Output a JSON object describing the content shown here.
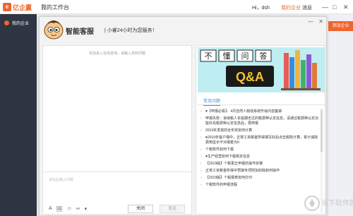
{
  "topbar": {
    "logo_text": "亿企赢",
    "workbench": "我的工作台",
    "user": "Hi，dsh",
    "my_corp": "我的企业",
    "messages": "消息",
    "win_min": "—",
    "win_max": "□",
    "win_close": "✕"
  },
  "sidebar": {
    "item": "我的企业"
  },
  "apply_btn": "添加企业",
  "chat_window": {
    "title": "智能客服",
    "subtitle": "| 小睿24小时为您服务！",
    "min": "—",
    "close": "✕",
    "welcome": "欢迎进入在线咨询，请输入您的问题",
    "input_placeholder": "请在此输入问题",
    "close_btn": "关闭",
    "send_btn": "发送",
    "tools": [
      "A",
      "🖼",
      "☺",
      "✂",
      "▾"
    ]
  },
  "right": {
    "banner_cn": [
      "不",
      "懂",
      "问",
      "答"
    ],
    "banner_en": "Q&A",
    "faq_tab": "常见问题",
    "faqs": [
      "♥【申报必看】：4月自然人税收系统升级内容集锦",
      "申报失败：该纳税人本属期无过的税费种认定信息，请通过税费种认定功能补充税费种认定信息后，再申报",
      "2019年发放的全年奖如何计算",
      "♥2019年客户端中，正常工资薪金所得填写好后点击税款计算，累计减除费用显示不对或者为0",
      "个税软件如何下载",
      "♥生产经营如何下载核定信息",
      "【2019版】个税更正申报的操作步骤",
      "正常工资薪金所得中预填专项附加扣除如何操作",
      "【2019版】个税报表如何打印",
      "个税软件的申报流程"
    ]
  },
  "watermark": "当下软件园"
}
